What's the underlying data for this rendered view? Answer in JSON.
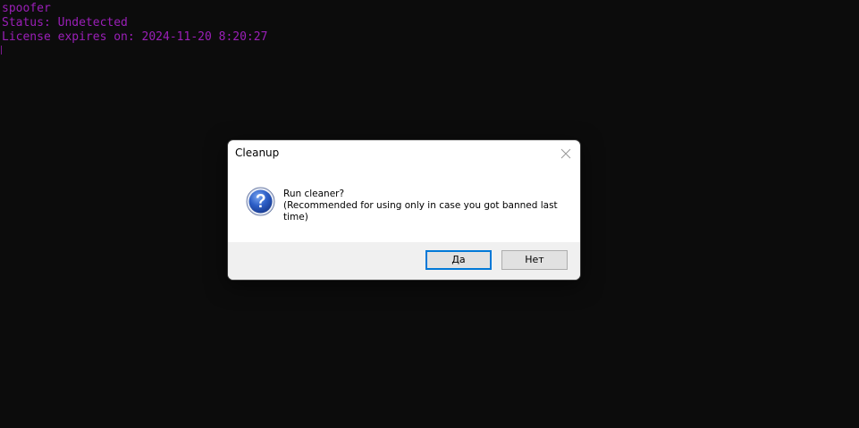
{
  "console": {
    "lines": [
      "spoofer",
      "Status: Undetected",
      "License expires on: 2024-11-20 8:20:27"
    ],
    "text_color": "#9b1fb8",
    "background": "#0c0c0c"
  },
  "dialog": {
    "title": "Cleanup",
    "icon": "question-icon",
    "message": {
      "line1": "Run cleaner?",
      "line2": "(Recommended for using only in case you got banned last time)"
    },
    "buttons": {
      "yes": "Да",
      "no": "Нет"
    },
    "close_icon": "close-icon"
  }
}
